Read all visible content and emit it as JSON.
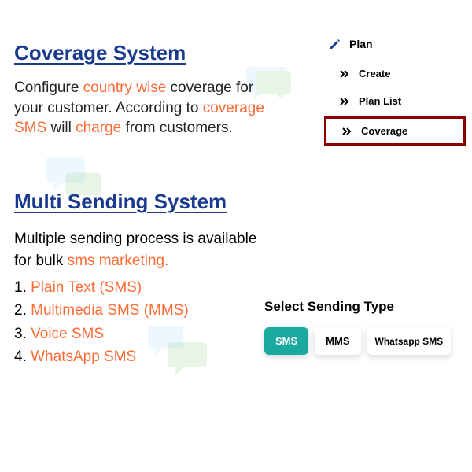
{
  "section1": {
    "title": "Coverage System ",
    "d1": "Configure ",
    "d1hl": "country wise",
    "d2": " coverage for your customer. According to ",
    "d2hl": "coverage SMS",
    "d3": " will ",
    "d3hl": "charge",
    "d4": " from customers."
  },
  "menu": {
    "top": "Plan",
    "items": {
      "0": "Create",
      "1": "Plan List",
      "2": "Coverage"
    }
  },
  "section2": {
    "title": "Multi Sending System",
    "intro1": "Multiple sending process is available for bulk ",
    "intro_hl": "sms marketing.",
    "li1_pre": " 1.  ",
    "li1": "Plain Text (SMS)",
    "li2_pre": "2. ",
    "li2": "Multimedia SMS (MMS)",
    "li3_pre": "3. ",
    "li3": "Voice SMS",
    "li4_pre": "4. ",
    "li4": "WhatsApp SMS"
  },
  "sending": {
    "title": "Select Sending Type",
    "b1": "SMS",
    "b2": "MMS",
    "b3": "Whatsapp SMS"
  }
}
